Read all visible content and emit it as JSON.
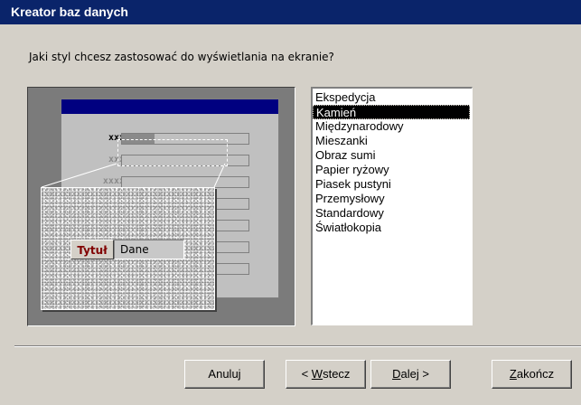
{
  "window": {
    "title": "Kreator baz danych"
  },
  "question": "Jaki styl chcesz zastosować do wyświetlania na ekranie?",
  "preview": {
    "field_labels": [
      "xxx",
      "xxx",
      "xxxx"
    ],
    "sample_label": "Tytuł",
    "sample_value": "Dane",
    "accent_color": "#800000"
  },
  "styles": {
    "items": [
      "Ekspedycja",
      "Kamień",
      "Międzynarodowy",
      "Mieszanki",
      "Obraz sumi",
      "Papier ryżowy",
      "Piasek pustyni",
      "Przemysłowy",
      "Standardowy",
      "Światłokopia"
    ],
    "selected": "Kamień"
  },
  "buttons": {
    "cancel": "Anuluj",
    "back_prefix": "< ",
    "back_key": "W",
    "back_rest": "stecz",
    "next_key": "D",
    "next_rest": "alej >",
    "finish_key": "Z",
    "finish_rest": "akończ"
  }
}
